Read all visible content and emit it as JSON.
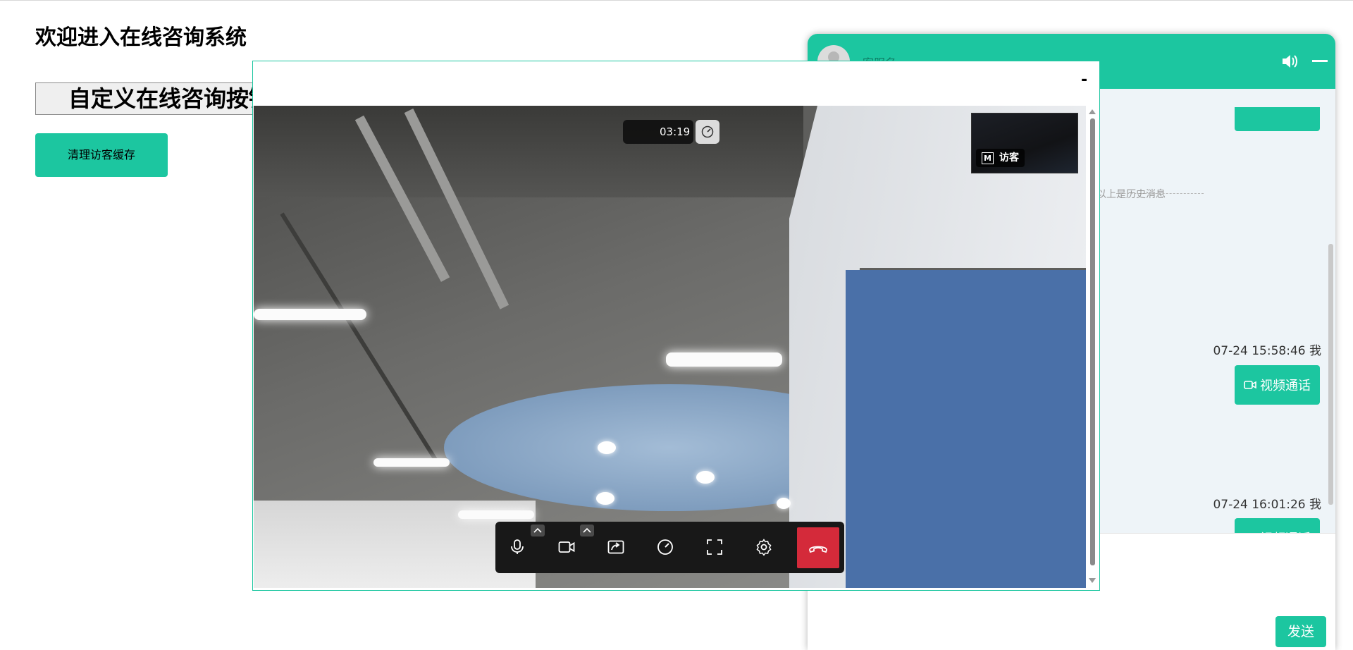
{
  "page": {
    "title": "欢迎进入在线咨询系统",
    "custom_button_label": "自定义在线咨询按钮",
    "clear_cache_label": "清理访客缓存"
  },
  "chat": {
    "agent_name": "客服名",
    "history_divider": "以上是历史消息",
    "messages": [
      {
        "time": "07-24 15:58:46 我",
        "content": "视频通话",
        "icon": "video-camera-icon"
      },
      {
        "time": "07-24 16:01:26 我",
        "content": "视频通话",
        "icon": "video-camera-icon"
      }
    ],
    "send_label": "发送",
    "header_icons": [
      "speaker-icon",
      "minimize-icon"
    ]
  },
  "video_call": {
    "minimize_label": "-",
    "timer": "03:19",
    "pip_label": "访客",
    "pip_badge": "M",
    "controls": [
      "microphone-icon",
      "camera-icon",
      "screen-share-icon",
      "speed-icon",
      "fullscreen-icon",
      "settings-icon",
      "hangup-icon"
    ]
  },
  "colors": {
    "accent": "#1cc6a0",
    "hangup": "#d42a3a",
    "control_bar": "#181818"
  }
}
